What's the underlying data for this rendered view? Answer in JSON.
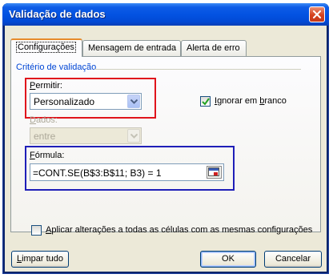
{
  "window": {
    "title": "Validação de dados"
  },
  "tabs": [
    {
      "label": "Configurações"
    },
    {
      "label": "Mensagem de entrada"
    },
    {
      "label": "Alerta de erro"
    }
  ],
  "group": {
    "title": "Critério de validação"
  },
  "permitir": {
    "label_key": "P",
    "label_rest": "ermitir:",
    "value": "Personalizado"
  },
  "ignorar": {
    "checked": true,
    "label_key": "I",
    "label_rest": "gnorar em ",
    "label_key2": "b",
    "label_rest2": "ranco"
  },
  "dados": {
    "label_key": "D",
    "label_rest": "ados:",
    "value": "entre"
  },
  "formula": {
    "label_key": "F",
    "label_rest": "órmula:",
    "value": "=CONT.SE(B$3:B$11; B3) = 1"
  },
  "aplicar": {
    "checked": false,
    "label_key": "A",
    "label_rest": "plicar alterações a todas as células com as mesmas configurações"
  },
  "buttons": {
    "clear_key": "L",
    "clear_rest": "impar tudo",
    "ok": "OK",
    "cancel": "Cancelar"
  }
}
